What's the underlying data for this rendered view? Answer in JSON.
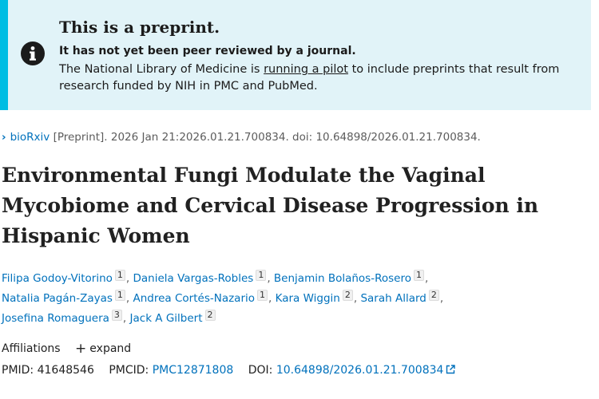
{
  "banner": {
    "title": "This is a preprint.",
    "strong_text": "It has not yet been peer reviewed by a journal.",
    "body_before": "The National Library of Medicine is ",
    "link_text": "running a pilot",
    "body_after": " to include preprints that result from research funded by NIH in PMC and PubMed."
  },
  "citation": {
    "journal": "bioRxiv",
    "rest": " [Preprint]. 2026 Jan 21:2026.01.21.700834. doi: 10.64898/2026.01.21.700834."
  },
  "article": {
    "title": "Environmental Fungi Modulate the Vaginal Mycobiome and Cervical Disease Progression in Hispanic Women"
  },
  "authors": [
    {
      "name": "Filipa Godoy-Vitorino",
      "aff": "1"
    },
    {
      "name": "Daniela Vargas-Robles",
      "aff": "1"
    },
    {
      "name": "Benjamin Bolaños-Rosero",
      "aff": "1"
    },
    {
      "name": "Natalia Pagán-Zayas",
      "aff": "1"
    },
    {
      "name": "Andrea Cortés-Nazario",
      "aff": "1"
    },
    {
      "name": "Kara Wiggin",
      "aff": "2"
    },
    {
      "name": "Sarah Allard",
      "aff": "2"
    },
    {
      "name": "Josefina Romaguera",
      "aff": "3"
    },
    {
      "name": "Jack A Gilbert",
      "aff": "2"
    }
  ],
  "affiliations": {
    "label": "Affiliations",
    "toggle": "+",
    "expand": "expand"
  },
  "identifiers": {
    "pmid_label": "PMID:",
    "pmid": "41648546",
    "pmcid_label": "PMCID:",
    "pmcid": "PMC12871808",
    "doi_label": "DOI:",
    "doi": "10.64898/2026.01.21.700834"
  },
  "icons": {
    "info": "info-circle-icon",
    "chevron": "chevron-right-icon",
    "external": "external-link-icon"
  },
  "colors": {
    "banner_bg": "#e1f3f8",
    "banner_accent": "#00bde3",
    "link": "#0071bc",
    "text": "#212121"
  }
}
